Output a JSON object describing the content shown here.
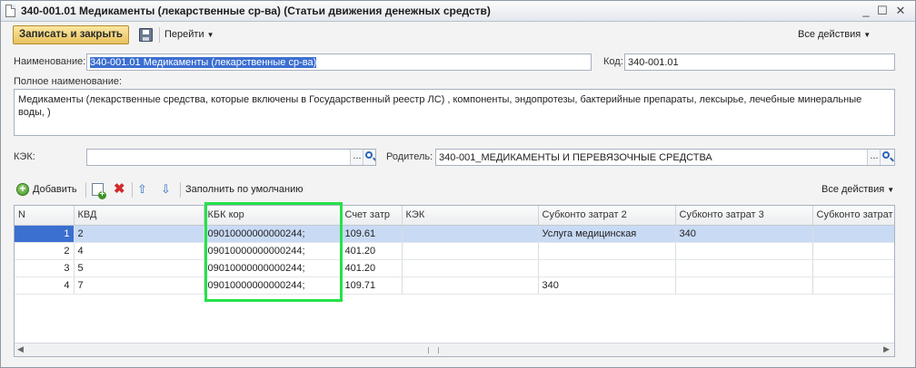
{
  "window": {
    "title": "340-001.01 Медикаменты (лекарственные ср-ва) (Статьи движения денежных средств)",
    "minimize": "_",
    "maximize": "☐",
    "close": "✕"
  },
  "toolbar": {
    "save_close_label": "Записать и закрыть",
    "goto_label": "Перейти",
    "all_actions_label": "Все действия"
  },
  "form": {
    "name_label": "Наименование:",
    "name_value": "340-001.01 Медикаменты (лекарственные ср-ва)",
    "code_label": "Код:",
    "code_value": "340-001.01",
    "fullname_label": "Полное наименование:",
    "fullname_value": "Медикаменты (лекарственные средства, которые включены в Государственный реестр ЛС) , компоненты, эндопротезы, бактерийные препараты, лексырье, лечебные минеральные воды, )",
    "kek_label": "КЭК:",
    "kek_value": "",
    "parent_label": "Родитель:",
    "parent_value": "340-001_МЕДИКАМЕНТЫ И ПЕРЕВЯЗОЧНЫЕ СРЕДСТВА",
    "pick_glyph": "...",
    "icons": {
      "search": "search-icon",
      "save": "save-disk-icon"
    }
  },
  "table_toolbar": {
    "add_label": "Добавить",
    "fill_default_label": "Заполнить по умолчанию",
    "all_actions_label": "Все действия"
  },
  "table": {
    "columns": [
      "N",
      "КВД",
      "КБК кор",
      "Счет затр",
      "КЭК",
      "Субконто затрат 2",
      "Субконто затрат 3",
      "Субконто затрат"
    ],
    "rows": [
      [
        "1",
        "2",
        "09010000000000244;",
        "109.61",
        "",
        "Услуга медицинская",
        "340",
        ""
      ],
      [
        "2",
        "4",
        "09010000000000244;",
        "401.20",
        "",
        "",
        "",
        ""
      ],
      [
        "3",
        "5",
        "09010000000000244;",
        "401.20",
        "",
        "",
        "",
        ""
      ],
      [
        "4",
        "7",
        "09010000000000244;",
        "109.71",
        "",
        "340",
        "",
        ""
      ]
    ]
  },
  "colors": {
    "accent": "#e9c15c",
    "selection": "#c9daf5",
    "highlight_box": "#24e24a"
  }
}
